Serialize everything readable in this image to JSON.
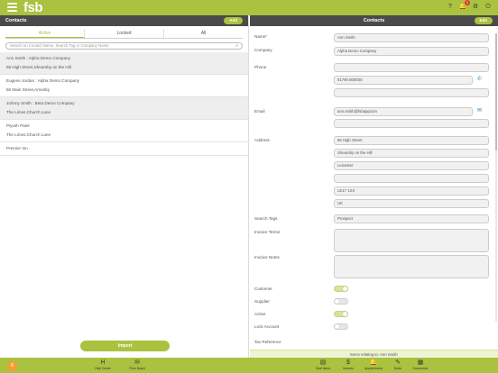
{
  "app": {
    "logo": "fsb",
    "logo_mark": "®"
  },
  "topbar": {
    "icons": [
      {
        "name": "help-icon",
        "glyph": "?"
      },
      {
        "name": "notifications-icon",
        "glyph": "🔔",
        "badge": "1"
      },
      {
        "name": "settings-icon",
        "glyph": "⚙"
      },
      {
        "name": "power-icon",
        "glyph": "⏻"
      }
    ]
  },
  "left": {
    "title": "Contacts",
    "add_label": "Add",
    "tabs": [
      "Active",
      "Locked",
      "All"
    ],
    "search_placeholder": "Search on Contact Name, Search Tag or Company Name",
    "contacts": [
      {
        "line1": "Ann Smith : Alpha Demo Company",
        "line2": "56 High Street,Shearsby on the Hill"
      },
      {
        "line1": "Eugene Jordan : Alpha Demo Company",
        "line2": "56 Main Street,Arnesby"
      },
      {
        "line1": "Johnny Smith : Beta Demo Company",
        "line2": "The Limes,Church Lane"
      },
      {
        "line1": "Piyush Patel",
        "line2": "The Limes,Church Lane"
      },
      {
        "line1": "Premier Inn",
        "line2": ""
      }
    ],
    "import_label": "Import"
  },
  "right": {
    "title": "Contacts",
    "edit_label": "Edit",
    "fields": {
      "name_label": "Name",
      "name_req": "*",
      "name": "Ann Smith",
      "company_label": "Company",
      "company": "Alpha Demo Company",
      "phone_label": "Phone",
      "phone1": "",
      "phone2": "01790 800000",
      "phone3": "",
      "email_label": "Email",
      "email1": "ann.smith@fsbappcom",
      "email2": "",
      "address_label": "Address",
      "address": [
        "56 High Street",
        "Shearsby on the Hill",
        "Leicester",
        "",
        "LE17 1XX",
        "UK"
      ],
      "search_tags_label": "Search Tags",
      "search_tags": "Prospect",
      "invoice_terms_label": "Invoice Terms",
      "invoice_notes_label": "Invoice Notes",
      "customer_label": "Customer",
      "supplier_label": "Supplier",
      "active_label": "Active",
      "lock_label": "Lock Account",
      "tax_label": "Tax Reference"
    },
    "toggles": {
      "customer": true,
      "supplier": false,
      "active": true,
      "lock": false
    },
    "related_banner": "Items relating to: Ann Smith"
  },
  "bottom": {
    "fab": "8",
    "left_nav": [
      {
        "label": "Help Centre",
        "glyph": "H"
      },
      {
        "label": "Price Board",
        "glyph": "✉"
      }
    ],
    "right_nav": [
      {
        "label": "Deal Items",
        "glyph": "▤"
      },
      {
        "label": "Invoices",
        "glyph": "$"
      },
      {
        "label": "Appointments",
        "glyph": "🔔"
      },
      {
        "label": "Notes",
        "glyph": "✎",
        "badge": "1"
      },
      {
        "label": "Documents",
        "glyph": "▦"
      }
    ]
  },
  "colors": {
    "accent": "#a9c23f",
    "header": "#4a4a4a",
    "link": "#2a7fb3"
  }
}
